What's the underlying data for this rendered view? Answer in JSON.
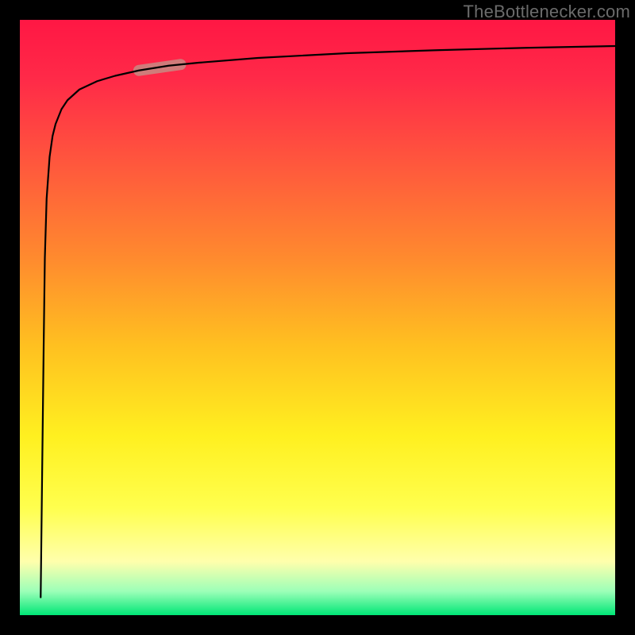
{
  "watermark": {
    "text": "TheBottlenecker.com"
  },
  "chart_data": {
    "type": "line",
    "title": "",
    "xlabel": "",
    "ylabel": "",
    "xlim": [
      0,
      100
    ],
    "ylim": [
      0,
      100
    ],
    "grid": false,
    "background_gradient": {
      "direction": "vertical",
      "stops": [
        {
          "pos": 0,
          "color": "#ff1744"
        },
        {
          "pos": 10,
          "color": "#ff2a48"
        },
        {
          "pos": 25,
          "color": "#ff5a3c"
        },
        {
          "pos": 40,
          "color": "#ff8a2e"
        },
        {
          "pos": 55,
          "color": "#ffc120"
        },
        {
          "pos": 70,
          "color": "#fff020"
        },
        {
          "pos": 82,
          "color": "#ffff4e"
        },
        {
          "pos": 91,
          "color": "#ffffac"
        },
        {
          "pos": 96,
          "color": "#9cffb8"
        },
        {
          "pos": 100,
          "color": "#00e676"
        }
      ]
    },
    "series": [
      {
        "name": "main-curve",
        "color": "#000000",
        "x": [
          3.5,
          3.7,
          4.0,
          4.2,
          4.5,
          5.0,
          5.5,
          6.0,
          7.0,
          8.0,
          10.0,
          13.0,
          16.0,
          20.0,
          25.0,
          30.0,
          40.0,
          55.0,
          70.0,
          85.0,
          100.0
        ],
        "y": [
          3.0,
          20.0,
          45.0,
          60.0,
          70.0,
          77.0,
          80.5,
          82.5,
          85.0,
          86.5,
          88.3,
          89.7,
          90.6,
          91.5,
          92.3,
          92.8,
          93.6,
          94.4,
          94.9,
          95.3,
          95.6
        ]
      }
    ],
    "highlight_segment": {
      "x_start": 20,
      "x_end": 27,
      "color": "#c78b84",
      "width": 14
    }
  }
}
